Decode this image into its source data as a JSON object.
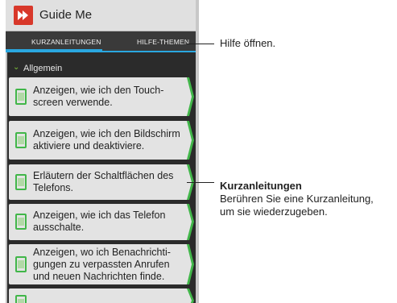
{
  "app": {
    "title": "Guide Me"
  },
  "tabs": [
    {
      "label": "KURZANLEITUNGEN"
    },
    {
      "label": "HILFE-THEMEN"
    }
  ],
  "section": {
    "label": "Allgemein"
  },
  "items": [
    {
      "line1": "Anzeigen, wie ich den Touch-",
      "line2": "screen verwende.",
      "line3": ""
    },
    {
      "line1": "Anzeigen, wie ich den Bildschirm",
      "line2": "aktiviere und deaktiviere.",
      "line3": ""
    },
    {
      "line1": "Erläutern der Schaltflächen des",
      "line2": "Telefons.",
      "line3": ""
    },
    {
      "line1": "Anzeigen, wie ich das Telefon",
      "line2": "ausschalte.",
      "line3": ""
    },
    {
      "line1": "Anzeigen, wo ich Benachrichti-",
      "line2": "gungen zu verpassten Anrufen",
      "line3": "und neuen Nachrichten finde."
    }
  ],
  "callouts": {
    "help": {
      "text": "Hilfe öffnen."
    },
    "tutorials": {
      "title": "Kurzanleitungen",
      "line1": "Berühren Sie eine Kurzanleitung,",
      "line2": "um sie wiederzugeben."
    }
  },
  "icons": {
    "app": "guide-me-app-icon",
    "section": "chevron-down-icon",
    "item": "phone-icon",
    "arrow": "chevron-right-icon"
  },
  "colors": {
    "accent_blue": "#2aa7e0",
    "accent_green": "#41b649",
    "app_red": "#d8382a"
  }
}
